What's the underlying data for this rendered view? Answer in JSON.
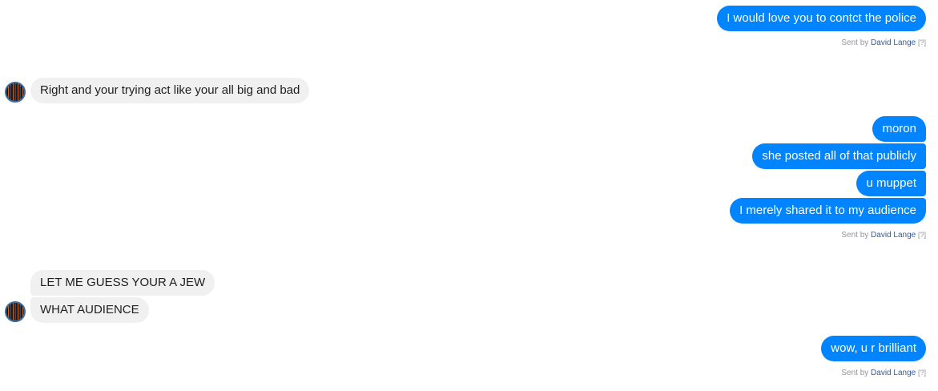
{
  "thread": {
    "sent_by_prefix": "Sent by",
    "sender_name": "David Lange",
    "help_marker": "[?]",
    "avatar_icon": "contact-avatar",
    "colors": {
      "outgoing_bubble": "#0084ff",
      "incoming_bubble": "#f1f0f0",
      "sender_link": "#385898",
      "receipt_text": "#90949c"
    },
    "groups": [
      {
        "direction": "outgoing",
        "messages": [
          "I would love you to contct the police"
        ]
      },
      {
        "direction": "incoming",
        "messages": [
          "Right and your trying act like your all big and bad"
        ]
      },
      {
        "direction": "outgoing",
        "messages": [
          "moron",
          "she posted all of that publicly",
          "u muppet",
          "I merely shared it to my audience"
        ]
      },
      {
        "direction": "incoming",
        "messages": [
          "LET ME GUESS YOUR A JEW",
          "WHAT AUDIENCE"
        ]
      },
      {
        "direction": "outgoing",
        "messages": [
          "wow, u r brilliant"
        ]
      }
    ]
  }
}
